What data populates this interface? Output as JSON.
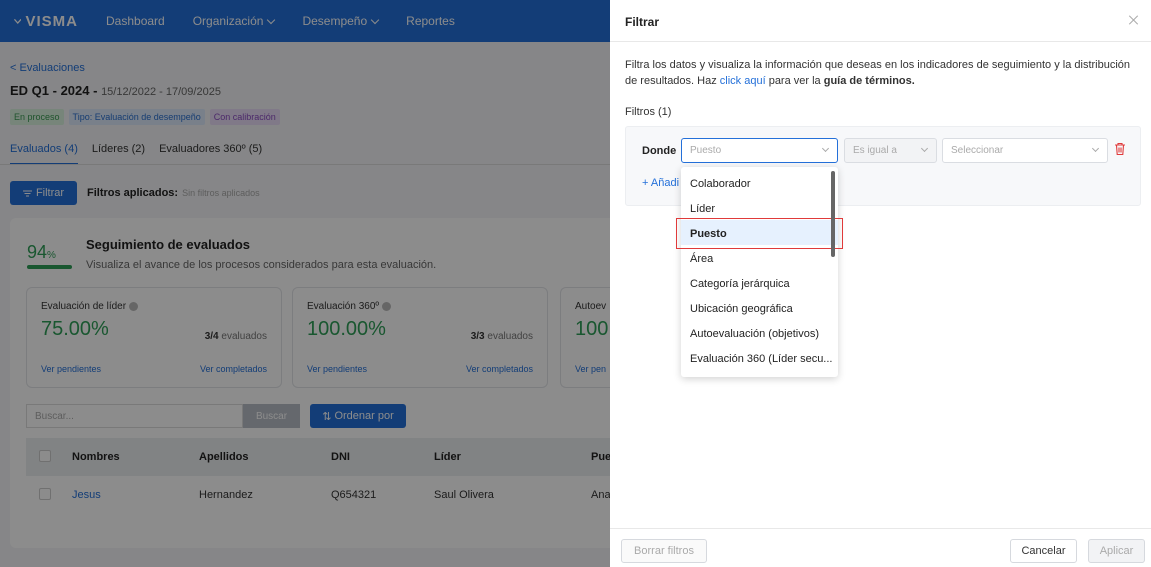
{
  "nav": {
    "logo": "VISMA",
    "items": [
      "Dashboard",
      "Organización",
      "Desempeño",
      "Reportes"
    ]
  },
  "page": {
    "back_link": "< Evaluaciones",
    "title": "ED Q1 - 2024 -",
    "dates": "15/12/2022 - 17/09/2025",
    "badges": [
      "En proceso",
      "Tipo: Evaluación de desempeño",
      "Con calibración"
    ],
    "tabs": [
      "Evaluados (4)",
      "Líderes (2)",
      "Evaluadores 360º (5)"
    ],
    "filter_button": "Filtrar",
    "applied_label": "Filtros aplicados:",
    "applied_value": "Sin filtros aplicados",
    "tracking": {
      "percent": "94",
      "percent_sign": "%",
      "progress": 0.94,
      "title": "Seguimiento de evaluados",
      "subtitle": "Visualiza el avance de los procesos considerados para esta evaluación."
    },
    "metrics": [
      {
        "title": "Evaluación de líder",
        "value": "75.00%",
        "count_num": "3/4",
        "count_text": "evaluados",
        "link_pending": "Ver pendientes",
        "link_done": "Ver completados"
      },
      {
        "title": "Evaluación 360º",
        "value": "100.00%",
        "count_num": "3/3",
        "count_text": "evaluados",
        "link_pending": "Ver pendientes",
        "link_done": "Ver completados"
      },
      {
        "title": "Autoev",
        "value": "100",
        "link_pending": "Ver pen"
      }
    ],
    "search_placeholder": "Buscar...",
    "search_button": "Buscar",
    "order_button": "Ordenar por",
    "table": {
      "headers": [
        "Nombres",
        "Apellidos",
        "DNI",
        "Líder",
        "Pue"
      ],
      "rows": [
        [
          "Jesus",
          "Hernandez",
          "Q654321",
          "Saul Olivera",
          "Ana"
        ]
      ]
    }
  },
  "drawer": {
    "title": "Filtrar",
    "desc_1": "Filtra los datos y visualiza la información que deseas en los indicadores de seguimiento y la distribución de resultados. Haz ",
    "desc_link": "click aquí",
    "desc_2": " para ver la ",
    "desc_bold": "guía de términos.",
    "filters_label": "Filtros (1)",
    "donde": "Donde",
    "field_placeholder": "Puesto",
    "operator_placeholder": "Es igual a",
    "value_placeholder": "Seleccionar",
    "add_label": "+ Añadi",
    "options": [
      "Colaborador",
      "Líder",
      "Puesto",
      "Área",
      "Categoría jerárquica",
      "Ubicación geográfica",
      "Autoevaluación (objetivos)",
      "Evaluación 360 (Líder secu..."
    ],
    "selected_option": "Puesto",
    "clear_button": "Borrar filtros",
    "cancel_button": "Cancelar",
    "apply_button": "Aplicar"
  },
  "colors": {
    "primary": "#2470d9",
    "success": "#2f9e58",
    "danger": "#e03a3a"
  }
}
